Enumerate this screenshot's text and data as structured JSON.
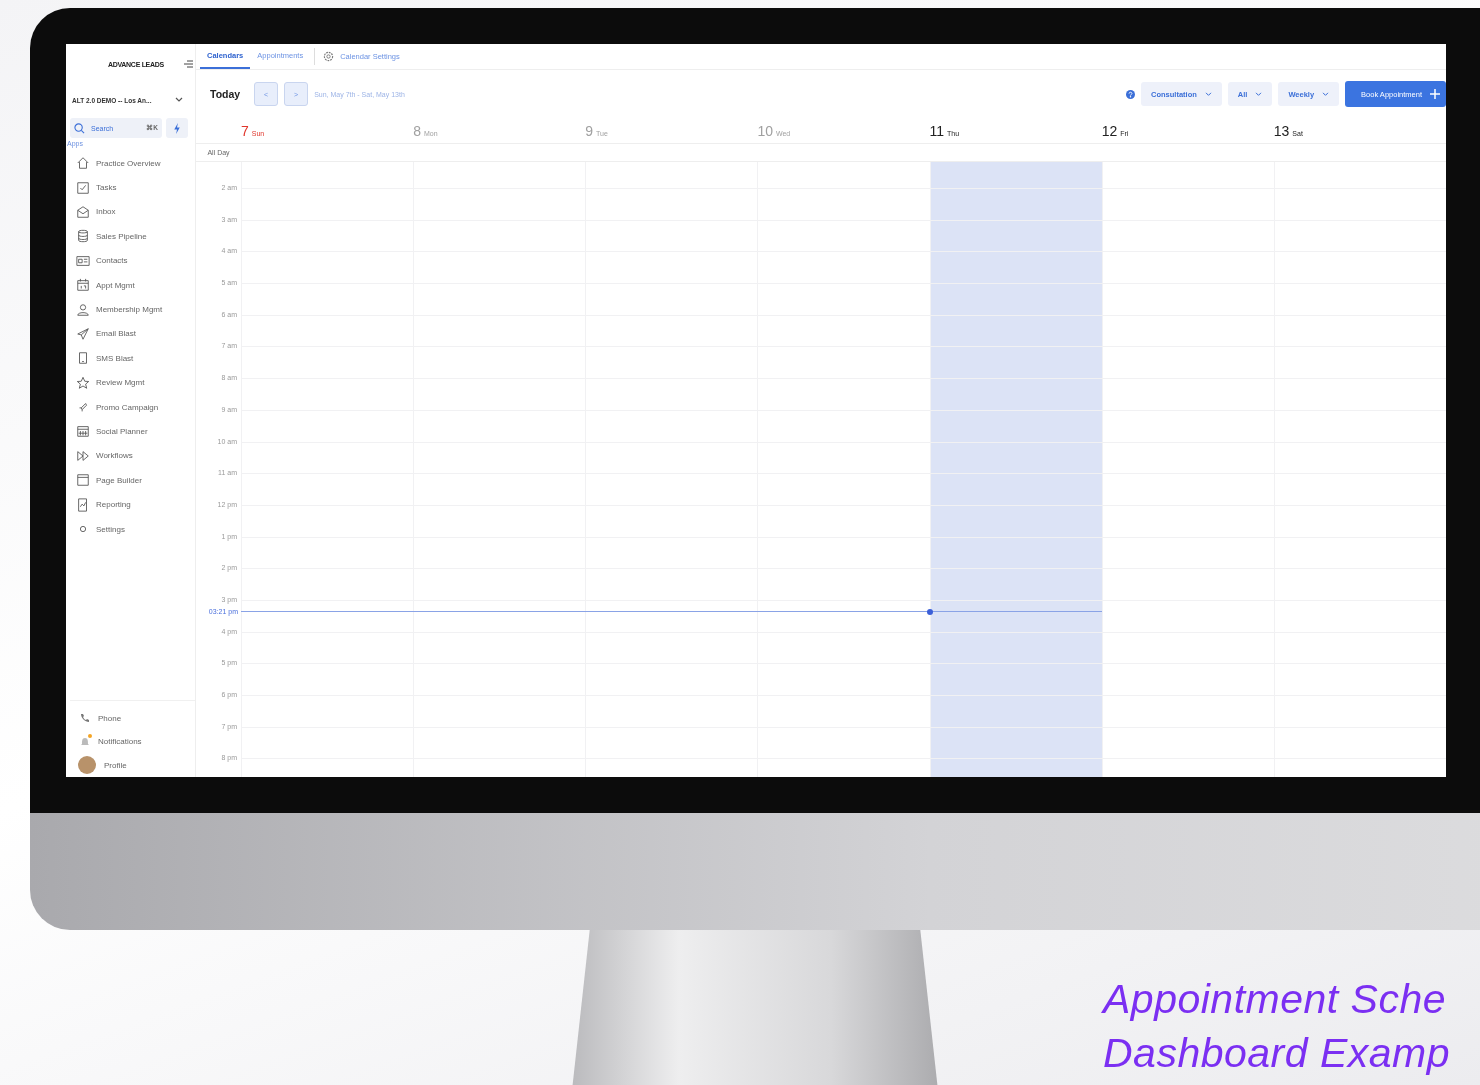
{
  "logo": "ADVANCE LEADS",
  "tabs": [
    {
      "label": "Calendars",
      "selected": true
    },
    {
      "label": "Appointments",
      "selected": false
    }
  ],
  "settings_link": "Calendar Settings",
  "location": "ALT 2.0 DEMO -- Los An...",
  "search": {
    "placeholder": "Search",
    "shortcut": "⌘K"
  },
  "apps_label": "Apps",
  "nav": [
    {
      "label": "Practice Overview"
    },
    {
      "label": "Tasks"
    },
    {
      "label": "Inbox"
    },
    {
      "label": "Sales Pipeline"
    },
    {
      "label": "Contacts"
    },
    {
      "label": "Appt Mgmt"
    },
    {
      "label": "Membership Mgmt"
    },
    {
      "label": "Email Blast"
    },
    {
      "label": "SMS Blast"
    },
    {
      "label": "Review Mgmt"
    },
    {
      "label": "Promo Campaign"
    },
    {
      "label": "Social Planner"
    },
    {
      "label": "Workflows"
    },
    {
      "label": "Page Builder"
    },
    {
      "label": "Reporting"
    },
    {
      "label": "Settings"
    }
  ],
  "bottom_nav": [
    {
      "kind": "phone",
      "label": "Phone",
      "badge": false
    },
    {
      "kind": "notifications",
      "label": "Notifications",
      "badge": true
    },
    {
      "kind": "profile",
      "label": "Profile",
      "badge": false
    }
  ],
  "toolbar": {
    "today": "Today",
    "prev": "<",
    "next": ">",
    "range": "Sun, May 7th - Sat, May 13th",
    "filters": [
      {
        "label": "Consultation"
      },
      {
        "label": "All"
      },
      {
        "label": "Weekly"
      }
    ],
    "book": "Book Appointment"
  },
  "days": [
    {
      "number": "7",
      "weekday": "Sun",
      "color": "#e0362c",
      "selected": false
    },
    {
      "number": "8",
      "weekday": "Mon",
      "color": "#a0a0a0",
      "selected": false
    },
    {
      "number": "9",
      "weekday": "Tue",
      "color": "#a0a0a0",
      "selected": false
    },
    {
      "number": "10",
      "weekday": "Wed",
      "color": "#a0a0a0",
      "selected": false
    },
    {
      "number": "11",
      "weekday": "Thu",
      "color": "#222222",
      "selected": true
    },
    {
      "number": "12",
      "weekday": "Fri",
      "color": "#222222",
      "selected": false
    },
    {
      "number": "13",
      "weekday": "Sat",
      "color": "#222222",
      "selected": false
    }
  ],
  "all_day": "All Day",
  "hours": [
    {
      "label": "2 am"
    },
    {
      "label": "3 am"
    },
    {
      "label": "4 am"
    },
    {
      "label": "5 am"
    },
    {
      "label": "6 am"
    },
    {
      "label": "7 am"
    },
    {
      "label": "8 am"
    },
    {
      "label": "9 am"
    },
    {
      "label": "10 am"
    },
    {
      "label": "11 am"
    },
    {
      "label": "12 pm"
    },
    {
      "label": "1 pm"
    },
    {
      "label": "2 pm"
    },
    {
      "label": "3 pm",
      "now": "03:21 pm"
    },
    {
      "label": "4 pm"
    },
    {
      "label": "5 pm"
    },
    {
      "label": "6 pm"
    },
    {
      "label": "7 pm"
    },
    {
      "label": "8 pm"
    }
  ],
  "caption": [
    "Appointment Sche",
    "Dashboard Examp"
  ]
}
